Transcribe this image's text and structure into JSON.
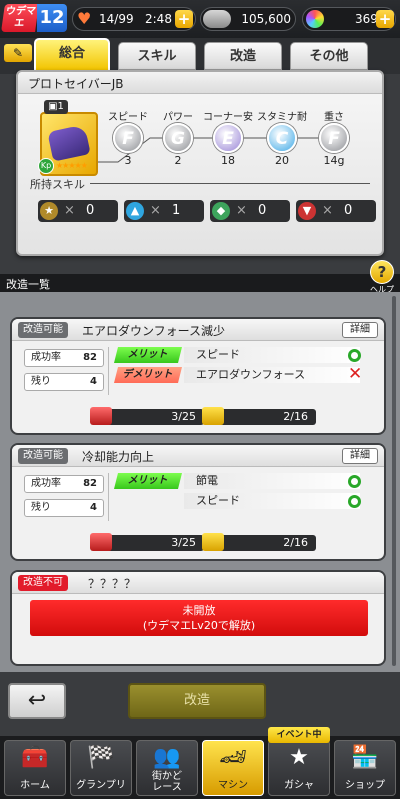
{
  "status": {
    "rank_label": "ウデマエ",
    "rank_level": "12",
    "stamina": "14/99",
    "timer": "2:48",
    "coins": "105,600",
    "gems": "369",
    "plus": "+"
  },
  "tabs": [
    "総合",
    "スキル",
    "改造",
    "その他"
  ],
  "machine": {
    "name": "プロトセイバーJB",
    "count": "1",
    "badge": "Kp",
    "stars": "★★★★★",
    "stats": [
      {
        "label": "スピード",
        "grade": "F",
        "value": "3",
        "color": "#8e9095"
      },
      {
        "label": "パワー",
        "grade": "G",
        "value": "2",
        "color": "#8e9095"
      },
      {
        "label": "コーナー安定",
        "grade": "E",
        "value": "18",
        "color": "#9a86d6"
      },
      {
        "label": "スタミナ耐久",
        "grade": "C",
        "value": "20",
        "color": "#3fa9e6"
      },
      {
        "label": "重さ",
        "grade": "F",
        "value": "14g",
        "color": "#8e9095"
      }
    ],
    "skills_label": "所持スキル",
    "skills": [
      {
        "icon": "star-icon",
        "x": "×",
        "count": "0",
        "color": "#b08a2a"
      },
      {
        "icon": "arrow-up-icon",
        "x": "×",
        "count": "1",
        "color": "#2fa6e0"
      },
      {
        "icon": "diamond-icon",
        "x": "×",
        "count": "0",
        "color": "#3da45c"
      },
      {
        "icon": "arrow-down-icon",
        "x": "×",
        "count": "0",
        "color": "#c33"
      }
    ]
  },
  "section_title": "改造一覧",
  "help_label": "ヘルプ",
  "help_icon": "?",
  "mods": [
    {
      "tag": "改造可能",
      "name": "エアロダウンフォース減少",
      "detail": "詳細",
      "success_label": "成功率",
      "success": "82",
      "remain_label": "残り",
      "remain": "4",
      "effects": [
        {
          "type": "メリット",
          "effect": "スピード",
          "result": "ok"
        },
        {
          "type": "デメリット",
          "effect": "エアロダウンフォース",
          "result": "ng"
        }
      ],
      "materials": [
        "3/25",
        "2/16"
      ]
    },
    {
      "tag": "改造可能",
      "name": "冷却能力向上",
      "detail": "詳細",
      "success_label": "成功率",
      "success": "82",
      "remain_label": "残り",
      "remain": "4",
      "effects": [
        {
          "type": "メリット",
          "effect": "節電",
          "result": "ok"
        },
        {
          "type": "",
          "effect": "スピード",
          "result": "ok"
        }
      ],
      "materials": [
        "3/25",
        "2/16"
      ]
    }
  ],
  "locked": {
    "tag": "改造不可",
    "name": "？？？？",
    "line1": "未開放",
    "line2": "(ウデマエLv20で解放)"
  },
  "bottom": {
    "back": "↩",
    "modify": "改造",
    "event_badge": "イベント中"
  },
  "nav": [
    {
      "label": "ホーム",
      "icon": "toolbox-icon",
      "glyph": "🧰"
    },
    {
      "label": "グランプリ",
      "icon": "checkered-flag-icon",
      "glyph": "🏁"
    },
    {
      "label": "街かど\nレース",
      "icon": "people-icon",
      "glyph": "👥"
    },
    {
      "label": "マシン",
      "icon": "car-icon",
      "glyph": "🏎"
    },
    {
      "label": "ガシャ",
      "icon": "star-icon",
      "glyph": "★"
    },
    {
      "label": "ショップ",
      "icon": "shop-icon",
      "glyph": "🏪"
    }
  ]
}
